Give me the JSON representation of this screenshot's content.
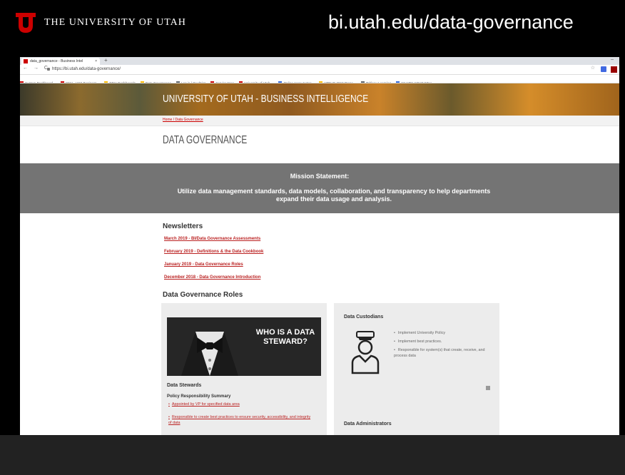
{
  "slide": {
    "university_name": "THE UNIVERSITY OF UTAH",
    "url_title": "bi.utah.edu/data-governance"
  },
  "browser": {
    "tab_title": "data_governance - Business Intel",
    "tab_close": "×",
    "new_tab": "+",
    "minimize": "–",
    "nav": "← → C",
    "url": "https://bi.utah.edu/data-governance/",
    "star": "☆",
    "bookmarks": [
      {
        "label": "System Dashboard...",
        "icon": "red"
      },
      {
        "label": "WIKI - USS Business...",
        "icon": "red"
      },
      {
        "label": "OBIA Dashboards",
        "icon": "folder"
      },
      {
        "label": "Data Governance",
        "icon": "folder"
      },
      {
        "label": "Log in | Qualtrics",
        "icon": "gray"
      },
      {
        "label": "Service Now",
        "icon": "red"
      },
      {
        "label": "University of Utah ...",
        "icon": "red"
      },
      {
        "label": "Online regex tester...",
        "icon": "blue"
      },
      {
        "label": "UTDUG 2019 Prese...",
        "icon": "folder"
      },
      {
        "label": "Tableau Learning",
        "icon": "gray"
      },
      {
        "label": "WHAT'S YOUR FINA...",
        "icon": "blue"
      }
    ]
  },
  "site": {
    "banner_title": "UNIVERSITY OF UTAH - BUSINESS INTELLIGENCE",
    "breadcrumb": "Home / Data Governance",
    "page_title": "DATA GOVERNANCE",
    "mission_heading": "Mission Statement:",
    "mission_text": "Utilize data management standards, data models, collaboration, and transparency to help departments expand their data usage and analysis.",
    "newsletters_heading": "Newsletters",
    "newsletters": [
      "March 2019 - BI/Data Governance Assessments",
      "February 2019 - Definitions & the Data Cookbook",
      "January 2019 - Data Governance Roles",
      "December 2018 - Data Governance Introduction"
    ],
    "roles_heading": "Data Governance Roles",
    "steward_image_text": "WHO IS A DATA STEWARD?",
    "stewards_heading": "Data Stewards",
    "policy_heading": "Policy Responsibility Summary",
    "steward_resp": [
      "Appointed by VP for specified data area",
      "Responsible to create best practices to ensure security, accessibility, and integrity of data"
    ],
    "custodians_heading": "Data Custodians",
    "custodian_bullets": [
      "Implement University Policy",
      "Implement best practices.",
      "Responsible for system(s) that create, receive, and process data"
    ],
    "administrators_heading": "Data Administrators"
  },
  "colors": {
    "utah_red": "#cc0000",
    "mission_bg": "#747474",
    "link_red": "#bb2222",
    "card_bg": "#ececec"
  }
}
